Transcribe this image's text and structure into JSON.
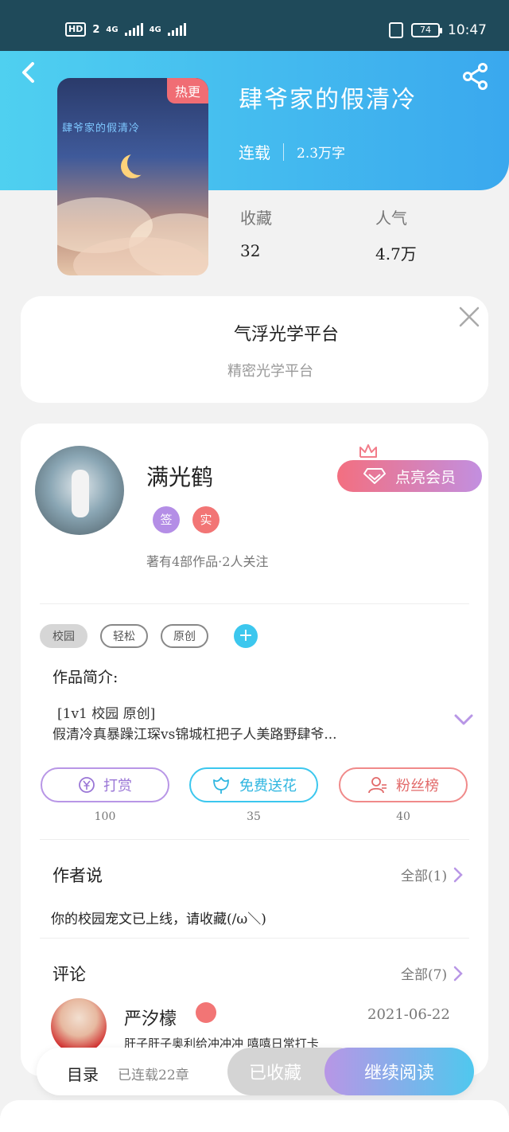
{
  "status_bar": {
    "hd": "HD",
    "sim": "2",
    "network1": "4G",
    "network2": "4G",
    "battery": "74",
    "time": "10:47"
  },
  "book": {
    "title": "肆爷家的假清冷",
    "cover_badge": "热更",
    "cover_text": "肆爷家的假清冷",
    "status": "连载",
    "words": "2.3万字",
    "favorites_label": "收藏",
    "favorites_value": "32",
    "popularity_label": "人气",
    "popularity_value": "4.7万"
  },
  "ad": {
    "title": "气浮光学平台",
    "subtitle": "精密光学平台"
  },
  "author": {
    "name": "满光鹤",
    "badge_sign": "签",
    "badge_real": "实",
    "stats": "著有4部作品·2人关注",
    "vip_button": "点亮会员"
  },
  "tags": [
    "校园",
    "轻松",
    "原创"
  ],
  "intro": {
    "label": "作品简介:",
    "line1": "[1v1  校园  原创]",
    "line2": "假清冷真暴躁江琛vs锦城杠把子人美路野肆爷..."
  },
  "actions": {
    "tip_label": "打赏",
    "tip_count": "100",
    "flower_label": "免费送花",
    "flower_count": "35",
    "fans_label": "粉丝榜",
    "fans_count": "40"
  },
  "author_says": {
    "title": "作者说",
    "more": "全部(1)",
    "text": "你的校园宠文已上线，请收藏(/ω＼)"
  },
  "comments": {
    "title": "评论",
    "more": "全部(7)",
    "user": "严汐檬",
    "date": "2021-06-22",
    "text": "肝子肝子奥利给冲冲冲   嘻嘻日常打卡"
  },
  "bottom": {
    "toc": "目录",
    "toc_count": "已连载22章",
    "collected": "已收藏",
    "read": "继续阅读"
  },
  "colors": {
    "header_start": "#4fd0f0",
    "header_end": "#3aa8ee",
    "accent_purple": "#b896e6",
    "accent_blue": "#3cc7ee",
    "accent_red": "#f27575"
  }
}
